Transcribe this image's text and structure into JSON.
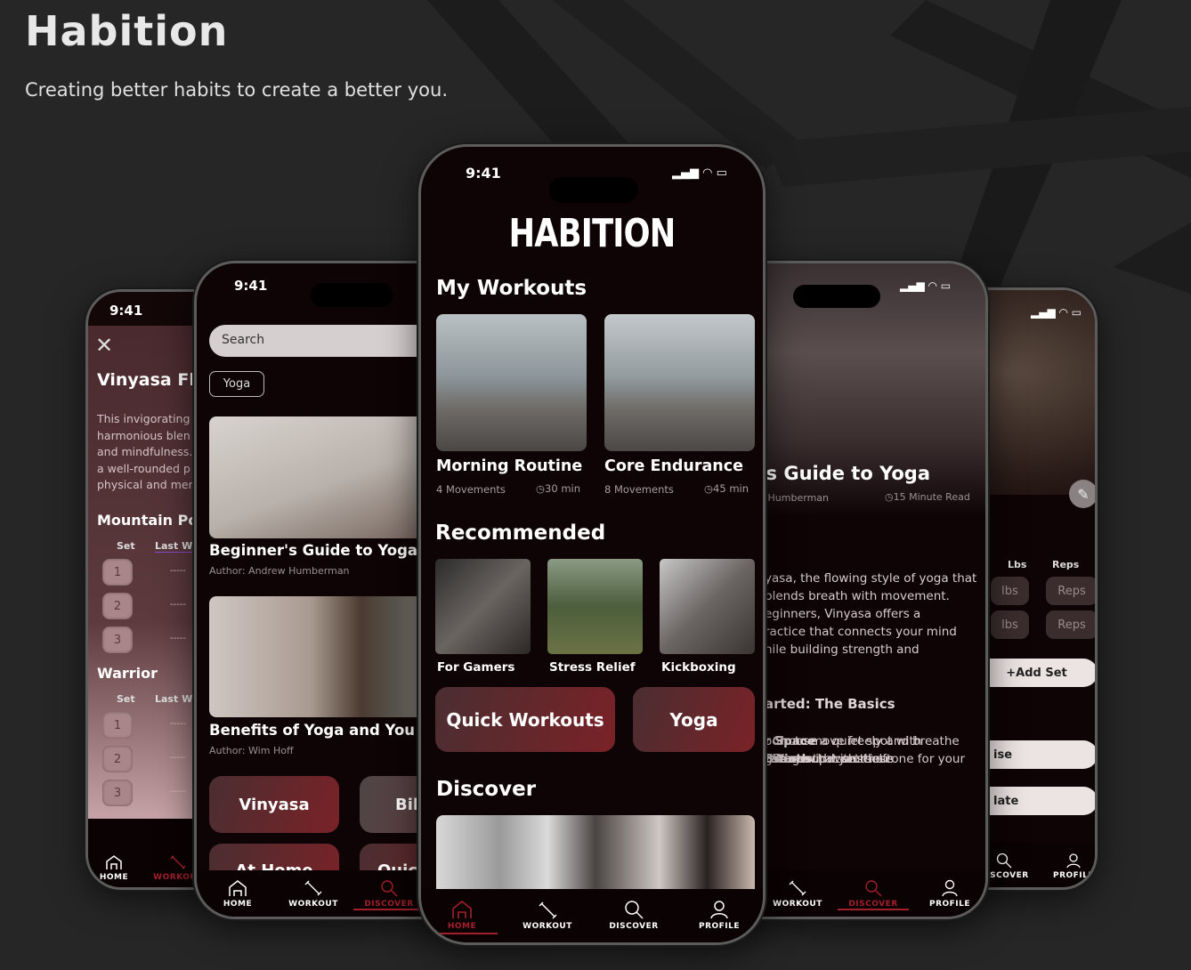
{
  "header": {
    "title": "Habition",
    "subtitle": "Creating better habits to create a better you."
  },
  "colors": {
    "background": "#262626",
    "screen": "#0e0305",
    "accent": "#a3202a",
    "card_gradient": [
      "#4a2e31",
      "#7a2227"
    ]
  },
  "status": {
    "time": "9:41"
  },
  "nav": {
    "home": "HOME",
    "workout": "WORKOUT",
    "discover": "DISCOVER",
    "profile": "PROFILE"
  },
  "phone_workout_detail": {
    "title": "Vinyasa Flo",
    "description": [
      "This invigorating ",
      "harmonious blen",
      "and mindfulness.",
      "a well-rounded p",
      "physical and men"
    ],
    "exercises": [
      {
        "name": "Mountain Po",
        "col_set": "Set",
        "col_last": "Last We",
        "sets": [
          "1",
          "2",
          "3"
        ],
        "last": [
          "-----",
          "-----",
          "-----"
        ]
      },
      {
        "name": "Warrior",
        "col_set": "Set",
        "col_last": "Last Wo",
        "sets": [
          "1",
          "2",
          "3"
        ],
        "last": [
          "-----",
          "-----",
          "-----"
        ]
      }
    ],
    "active_nav": "workout"
  },
  "phone_discover": {
    "search_placeholder": "Search",
    "filter_chip": "Yoga",
    "articles": [
      {
        "title": "Beginner's Guide to Yoga",
        "author": "Author: Andrew Humberman"
      },
      {
        "title": "Benefits of Yoga and You Wel",
        "author": "Author: Wim Hoff"
      }
    ],
    "categories": [
      "Vinyasa",
      "Bik",
      "At Home",
      "Quick"
    ],
    "active_nav": "discover"
  },
  "phone_home": {
    "logo": "HABITION",
    "my_workouts_heading": "My Workouts",
    "workouts": [
      {
        "title": "Morning Routine",
        "movements": "4 Movements",
        "duration": "30 min"
      },
      {
        "title": "Core Endurance",
        "movements": "8 Movements",
        "duration": "45 min"
      }
    ],
    "recommended_heading": "Recommended",
    "recommended": [
      "For Gamers",
      "Stress Relief",
      "Kickboxing"
    ],
    "categories": [
      "Quick Workouts",
      "Yoga"
    ],
    "discover_heading": "Discover",
    "active_nav": "home"
  },
  "phone_article": {
    "title": "Beginner’s Guide to Yoga",
    "author": "Author: Andrew Humberman",
    "read_time": "15 Minute Read",
    "intro": [
      "yasa, the flowing style of yoga that",
      "blends breath with movement.",
      "eginners, Vinyasa offers a",
      "ractice that connects your mind",
      "hile building strength and"
    ],
    "section_heading": "arted: The Basics",
    "section_lines": [
      {
        "bold": "r Space",
        "text": ": Choose a quiet spot with"
      },
      {
        "bold": "",
        "text": "oom to move freely and breathe"
      },
      {
        "bold": " Breath",
        "text": ": Start with conscious"
      },
      {
        "bold": "",
        "text": "g to ground yourself."
      },
      {
        "bold": "tations",
        "text": ": Warm up with these"
      },
      {
        "bold": "",
        "text": "ostures that set the tone for your"
      }
    ],
    "active_nav": "discover"
  },
  "phone_log": {
    "col_lbs": "Lbs",
    "col_reps": "Reps",
    "rows": [
      {
        "lbs": "lbs",
        "reps": "Reps"
      },
      {
        "lbs": "lbs",
        "reps": "Reps"
      }
    ],
    "add_set": "+Add Set",
    "button_1": "ise",
    "button_2": "late"
  }
}
